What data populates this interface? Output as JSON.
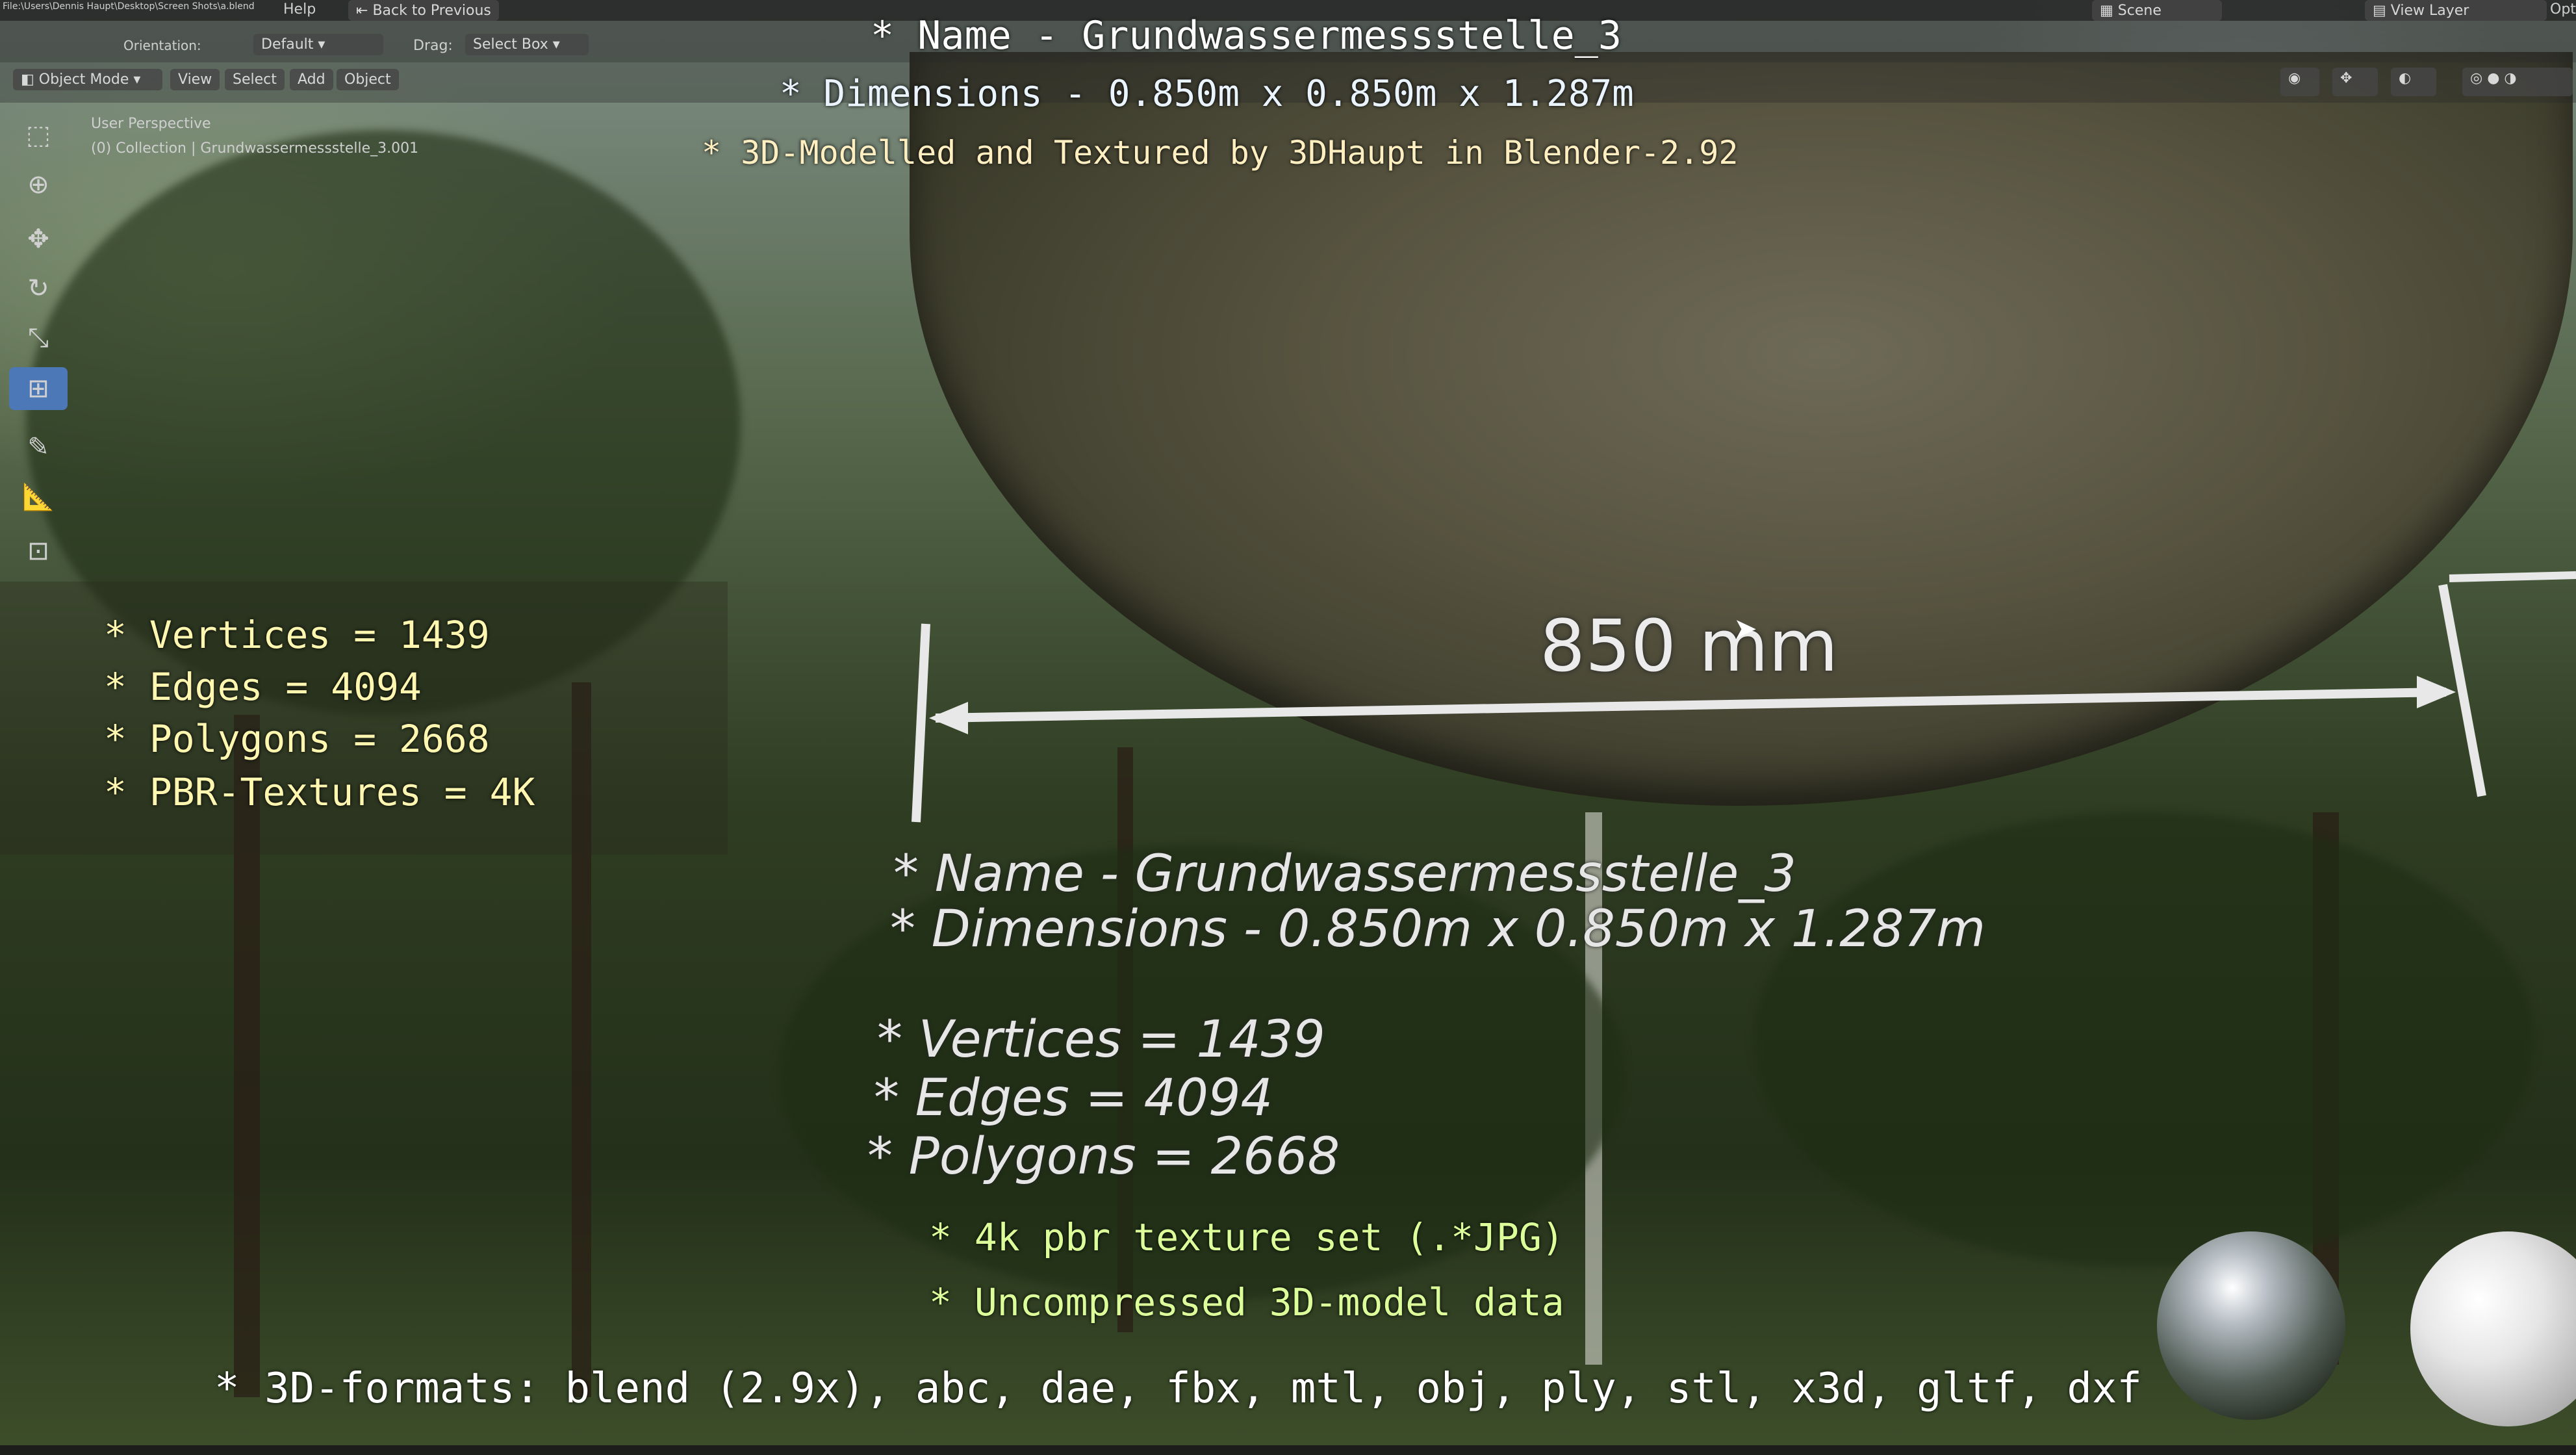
{
  "topbar": {
    "menu_file_path": "File:\\Users\\Dennis Haupt\\Desktop\\Screen Shots\\a.blend",
    "menu_help": "Help",
    "back_to_previous": "Back to Previous",
    "scene_label": "Scene",
    "view_layer_label": "View Layer",
    "options_label": "Opt"
  },
  "header": {
    "orientation_label": "Orientation:",
    "orientation_value": "Default",
    "drag_label": "Drag:",
    "drag_value": "Select Box"
  },
  "viewport_header": {
    "mode": "Object Mode",
    "view": "View",
    "select": "Select",
    "add": "Add",
    "object": "Object"
  },
  "viewport": {
    "perspective": "User Perspective",
    "collection": "(0) Collection | Grundwassermessstelle_3.001"
  },
  "overlay_top": {
    "name_line": "* Name - Grundwassermessstelle_3",
    "dimensions_line": "* Dimensions -  0.850m x 0.850m x 1.287m",
    "credits_line": "* 3D-Modelled and Textured by 3DHaupt in Blender-2.92"
  },
  "stats": {
    "vertices": "* Vertices = 1439",
    "edges": "* Edges = 4094",
    "polygons": "* Polygons = 2668",
    "textures": "* PBR-Textures = 4K"
  },
  "measurement": {
    "label": "850 mm"
  },
  "in_scene_text": {
    "name": "* Name - Grundwassermessstelle_3",
    "dimensions": "* Dimensions -  0.850m x 0.850m x 1.287m",
    "vertices": "* Vertices = 1439",
    "edges": "* Edges = 4094",
    "polygons": "* Polygons = 2668"
  },
  "features": {
    "texture_set": "* 4k pbr texture set (.*JPG)",
    "uncompressed": "* Uncompressed 3D-model data"
  },
  "formats": {
    "line": "* 3D-formats: blend (2.9x), abc, dae, fbx, mtl, obj, ply, stl, x3d, gltf, dxf"
  },
  "colors": {
    "active_tool": "#4d78b8",
    "stats_text": "#fff6b0",
    "feature_text": "#dcff9a"
  }
}
